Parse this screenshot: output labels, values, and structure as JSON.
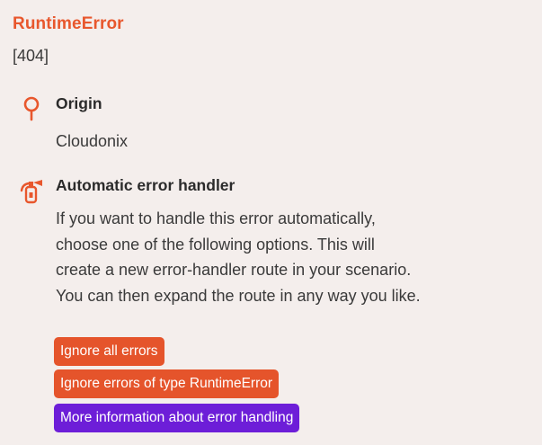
{
  "error": {
    "title": "RuntimeError",
    "code": "[404]"
  },
  "origin": {
    "icon": "map-pin-icon",
    "heading": "Origin",
    "value": "Cloudonix"
  },
  "handler": {
    "icon": "fire-extinguisher-icon",
    "heading": "Automatic error handler",
    "lines": [
      "If you want to handle this error automatically,",
      "choose one of the following options. This will",
      "create a new error-handler route in your scenario.",
      "You can then expand the route in any way you like."
    ]
  },
  "actions": {
    "ignore_all": "Ignore all errors",
    "ignore_type": "Ignore errors of type RuntimeError",
    "more_info": "More information about error handling"
  },
  "colors": {
    "background": "#f4eeec",
    "accent": "#e8572d",
    "button_orange": "#e5542b",
    "button_purple": "#6d1ed8"
  }
}
